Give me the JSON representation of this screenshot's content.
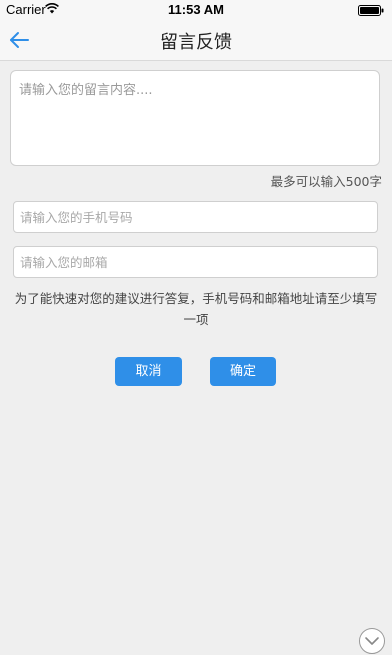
{
  "status_bar": {
    "carrier": "Carrier",
    "time": "11:53 AM",
    "wifi_icon": "wifi-icon",
    "battery_icon": "battery-icon"
  },
  "nav": {
    "title": "留言反馈",
    "back_icon": "back-arrow-icon",
    "accent_color": "#2f8fe8"
  },
  "form": {
    "message_placeholder": "请输入您的留言内容....",
    "char_limit": "最多可以输入500字",
    "phone_placeholder": "请输入您的手机号码",
    "email_placeholder": "请输入您的邮箱",
    "hint": "为了能快速对您的建议进行答复，手机号码和邮箱地址请至少填写一项"
  },
  "buttons": {
    "cancel_label": "取消",
    "confirm_label": "确定",
    "color": "#2f8fe8"
  },
  "footer": {
    "scroll_icon": "chevron-down-circle-icon"
  }
}
